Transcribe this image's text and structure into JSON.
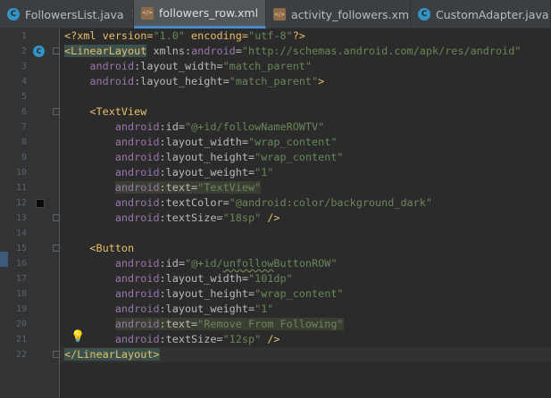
{
  "tabs": [
    {
      "label": "FollowersList.java",
      "icon": "java-class-icon",
      "active": false
    },
    {
      "label": "followers_row.xml",
      "icon": "xml-file-icon",
      "active": true
    },
    {
      "label": "activity_followers.xml",
      "icon": "xml-file-icon",
      "active": false
    },
    {
      "label": "CustomAdapter.java",
      "icon": "java-class-icon",
      "active": false
    }
  ],
  "line_numbers": [
    "1",
    "2",
    "3",
    "4",
    "5",
    "6",
    "7",
    "8",
    "9",
    "10",
    "11",
    "12",
    "13",
    "14",
    "15",
    "16",
    "17",
    "18",
    "19",
    "20",
    "21",
    "22"
  ],
  "code": {
    "l1_a": "<?xml version=",
    "l1_b": "\"1.0\"",
    "l1_c": " encoding=",
    "l1_d": "\"utf-8\"",
    "l1_e": "?>",
    "l2_tag": "<LinearLayout",
    "l2_attr": " xmlns:",
    "l2_ns": "android",
    "l2_eq": "=",
    "l2_val": "\"http://schemas.android.com/apk/res/android\"",
    "l3_ns": "android",
    "l3_attr": ":layout_width=",
    "l3_val": "\"match_parent\"",
    "l4_ns": "android",
    "l4_attr": ":layout_height=",
    "l4_val": "\"match_parent\"",
    "l4_end": ">",
    "l6_tag": "<TextView",
    "l7_ns": "android",
    "l7_attr": ":id=",
    "l7_val": "\"@+id/followNameROWTV\"",
    "l8_ns": "android",
    "l8_attr": ":layout_width=",
    "l8_val": "\"wrap_content\"",
    "l9_ns": "android",
    "l9_attr": ":layout_height=",
    "l9_val": "\"wrap_content\"",
    "l10_ns": "android",
    "l10_attr": ":layout_weight=",
    "l10_val": "\"1\"",
    "l11_ns": "android",
    "l11_attr": ":text=",
    "l11_val": "\"TextView\"",
    "l12_ns": "android",
    "l12_attr": ":textColor=",
    "l12_val": "\"@android:color/background_dark\"",
    "l13_ns": "android",
    "l13_attr": ":textSize=",
    "l13_val": "\"18sp\"",
    "l13_end": " />",
    "l15_tag": "<Button",
    "l16_ns": "android",
    "l16_attr": ":id=",
    "l16_val_a": "\"@+id/",
    "l16_val_b": "unfollow",
    "l16_val_c": "ButtonROW\"",
    "l17_ns": "android",
    "l17_attr": ":layout_width=",
    "l17_val": "\"101dp\"",
    "l18_ns": "android",
    "l18_attr": ":layout_height=",
    "l18_val": "\"wrap_content\"",
    "l19_ns": "android",
    "l19_attr": ":layout_weight=",
    "l19_val": "\"1\"",
    "l20_ns": "android",
    "l20_attr": ":text=",
    "l20_val": "\"Remove From Following\"",
    "l21_ns": "android",
    "l21_attr": ":textSize=",
    "l21_val": "\"12sp\"",
    "l21_end": " />",
    "l22_tag": "</LinearLayout>"
  },
  "gutter_marks": {
    "class_marker": "C",
    "swatch_color": "#0a0a0a"
  },
  "colors": {
    "tag": "#e8bf6a",
    "namespace": "#9876aa",
    "string": "#6a8759",
    "active_tab_underline": "#4a88c7"
  }
}
